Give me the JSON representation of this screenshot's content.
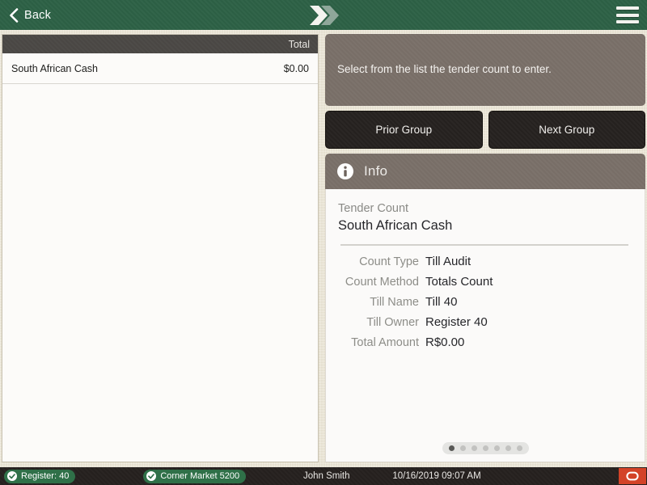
{
  "topbar": {
    "back_label": "Back",
    "logo_name": "x-brand-logo",
    "menu_name": "hamburger-menu"
  },
  "list_panel": {
    "column_header_total": "Total",
    "rows": [
      {
        "label": "South African Cash",
        "value": "$0.00"
      }
    ]
  },
  "right_panel": {
    "prompt": "Select from the list the tender count to enter.",
    "prior_group_label": "Prior Group",
    "next_group_label": "Next Group",
    "info_title": "Info",
    "tender_count_label": "Tender Count",
    "tender_count_value": "South African Cash",
    "fields": [
      {
        "key": "Count Type",
        "value": "Till Audit"
      },
      {
        "key": "Count Method",
        "value": "Totals Count"
      },
      {
        "key": "Till Name",
        "value": "Till 40"
      },
      {
        "key": "Till Owner",
        "value": "Register 40"
      },
      {
        "key": "Total Amount",
        "value": "R$0.00"
      }
    ],
    "pager": {
      "total": 7,
      "active_index": 0
    }
  },
  "statusbar": {
    "register_badge": "Register: 40",
    "store_badge": "Corner Market 5200",
    "user": "John Smith",
    "datetime": "10/16/2019 09:07 AM",
    "power_name": "power-logout-button"
  },
  "colors": {
    "header_green": "#2d6146",
    "app_cream": "#e9e3d1",
    "panel_taupe": "#7a7069",
    "button_dark": "#262220",
    "list_header_dark": "#4b4845",
    "badge_green": "#2f7048",
    "power_red": "#d34328"
  }
}
